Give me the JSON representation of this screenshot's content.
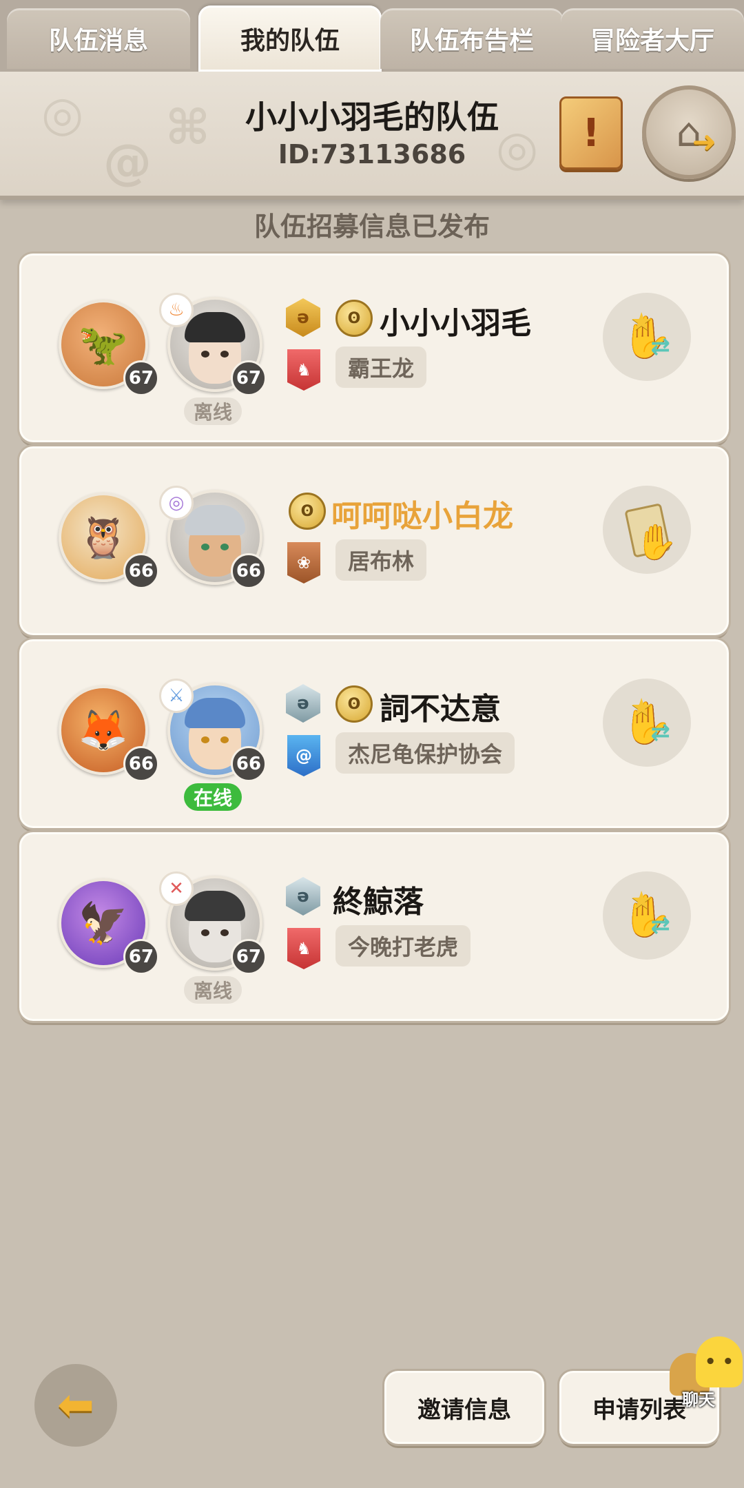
{
  "tabs": [
    {
      "label": "队伍消息",
      "active": false
    },
    {
      "label": "我的队伍",
      "active": true
    },
    {
      "label": "队伍布告栏",
      "active": false
    },
    {
      "label": "冒险者大厅",
      "active": false
    }
  ],
  "header": {
    "team_name": "小小小羽毛的队伍",
    "team_id": "ID:73113686",
    "notice_icon": "scroll-exclamation-icon",
    "exit_icon": "exit-team-icon"
  },
  "recruit_message": "队伍招募信息已发布",
  "members": [
    {
      "pet_level": "67",
      "hero_level": "67",
      "pet_icon": "dragon-pet-icon",
      "class_icon": "fire-class-icon",
      "class_color": "#f08a3a",
      "status": "离线",
      "online": false,
      "rank_badge": "gold",
      "has_coin": true,
      "name": "小小小羽毛",
      "name_color": "default",
      "guild_flag": "red",
      "guild": "霸王龙",
      "action_icon": "swap-hand-icon"
    },
    {
      "pet_level": "66",
      "hero_level": "66",
      "pet_icon": "owl-pet-icon",
      "class_icon": "magic-class-icon",
      "class_color": "#a77ad8",
      "status": "",
      "online": null,
      "rank_badge": "",
      "has_coin": true,
      "name": "呵呵哒小白龙",
      "name_color": "orange",
      "guild_flag": "brown",
      "guild": "居布林",
      "action_icon": "card-hand-icon"
    },
    {
      "pet_level": "66",
      "hero_level": "66",
      "pet_icon": "fox-pet-icon",
      "class_icon": "sword-class-icon",
      "class_color": "#6aa0e0",
      "status": "在线",
      "online": true,
      "rank_badge": "silver",
      "has_coin": true,
      "name": "詞不达意",
      "name_color": "default",
      "guild_flag": "blue",
      "guild": "杰尼龟保护协会",
      "action_icon": "swap-hand-icon"
    },
    {
      "pet_level": "67",
      "hero_level": "67",
      "pet_icon": "bird-pet-icon",
      "class_icon": "axe-class-icon",
      "class_color": "#e05a5a",
      "status": "离线",
      "online": false,
      "rank_badge": "silver",
      "has_coin": false,
      "name": "終鯨落",
      "name_color": "default",
      "guild_flag": "red",
      "guild": "今晚打老虎",
      "action_icon": "swap-hand-icon"
    }
  ],
  "bottom": {
    "invite_label": "邀请信息",
    "apply_label": "申请列表",
    "chat_label": "聊天",
    "back_icon": "back-arrow-icon"
  },
  "colors": {
    "background": "#c8bfb2",
    "card": "#f6f1e8",
    "online": "#3dbb3d",
    "highlight_name": "#e8a33a"
  }
}
